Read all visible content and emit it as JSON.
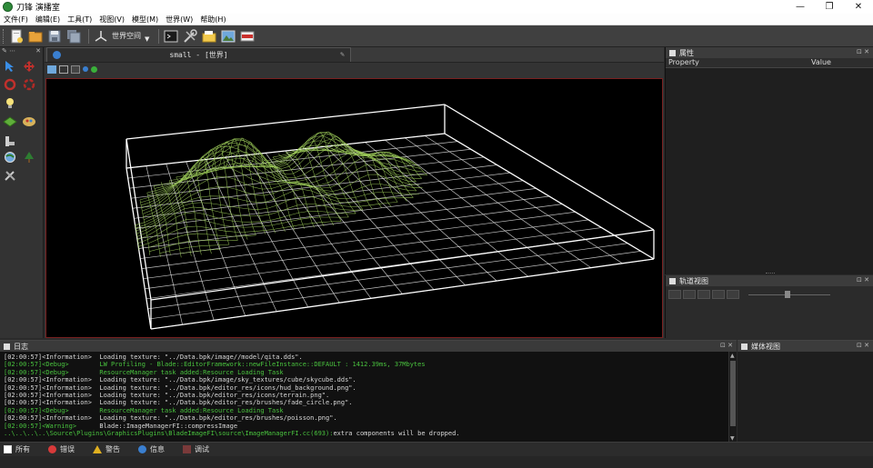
{
  "window": {
    "title": "刀锋 演播室",
    "controls": [
      "—",
      "❐",
      "✕"
    ]
  },
  "menu": [
    "文件(F)",
    "编辑(E)",
    "工具(T)",
    "视图(V)",
    "模型(M)",
    "世界(W)",
    "帮助(H)"
  ],
  "toolbar": {
    "space_select": "世界空间",
    "icons": [
      "new-file-icon",
      "open-folder-icon",
      "save-icon",
      "save-all-icon",
      "axis-icon",
      "console-icon",
      "settings-tools-icon",
      "folder-icon",
      "screenshot-icon",
      "film-icon"
    ]
  },
  "left_tools": [
    "select-arrow-icon",
    "move-red-icon",
    "rotate-red-icon",
    "scale-red-icon",
    "light-bulb-icon",
    "terrain-icon",
    "paint-brush-icon",
    "ruler-icon",
    "tree-icon",
    "globe-icon",
    "tools-icon"
  ],
  "viewport": {
    "tab_title": "small - [世界]"
  },
  "properties": {
    "title": "属性",
    "col_property": "Property",
    "col_value": "Value"
  },
  "track": {
    "title": "轨道视图"
  },
  "log": {
    "title": "日志",
    "lines": [
      {
        "level": "info",
        "text": "[02:00:57]<Information>  Loading texture: \"../Data.bpk/image//model/qita.dds\"."
      },
      {
        "level": "debug",
        "text": "[02:00:57]<Debug>        LW Profiling - Blade::EditorFramework::newFileInstance::DEFAULT : 1412.39ms, 37Mbytes"
      },
      {
        "level": "debug",
        "text": "[02:00:57]<Debug>        ResourceManager task added:Resource Loading Task"
      },
      {
        "level": "info",
        "text": "[02:00:57]<Information>  Loading texture: \"../Data.bpk/image/sky_textures/cube/skycube.dds\"."
      },
      {
        "level": "info",
        "text": "[02:00:57]<Information>  Loading texture: \"../Data.bpk/editor_res/icons/hud_background.png\"."
      },
      {
        "level": "info",
        "text": "[02:00:57]<Information>  Loading texture: \"../Data.bpk/editor_res/icons/terrain.png\"."
      },
      {
        "level": "info",
        "text": "[02:00:57]<Information>  Loading texture: \"../Data.bpk/editor_res/brushes/fade_circle.png\"."
      },
      {
        "level": "debug",
        "text": "[02:00:57]<Debug>        ResourceManager task added:Resource Loading Task"
      },
      {
        "level": "info",
        "text": "[02:00:57]<Information>  Loading texture: \"../Data.bpk/editor_res/brushes/poisson.png\"."
      },
      {
        "level": "warn",
        "tag": "[02:00:57]<Warning>",
        "text": "      Blade::ImageManagerFI::compressImage"
      },
      {
        "level": "warn",
        "tag": "..\\..\\..\\..\\Source\\Plugins\\GraphicsPlugins\\BladeImageFI\\source\\ImageManagerFI.cc(693):",
        "text": "extra components will be dropped."
      }
    ]
  },
  "media": {
    "title": "媒体视图"
  },
  "filters": [
    {
      "label": "所有",
      "icon": "all-icon",
      "color": "#dcdcdc"
    },
    {
      "label": "错误",
      "icon": "error-icon",
      "color": "#d83a3a"
    },
    {
      "label": "警告",
      "icon": "warning-icon",
      "color": "#e0b020"
    },
    {
      "label": "信息",
      "icon": "info-icon",
      "color": "#3a7fd0"
    },
    {
      "label": "调试",
      "icon": "debug-icon",
      "color": "#7a3a3a"
    }
  ],
  "colors": {
    "terrain_wire": "#9fce5a",
    "grid_wire": "#ffffff",
    "viewport_border": "#7a2020",
    "debug_text": "#49c23e"
  }
}
